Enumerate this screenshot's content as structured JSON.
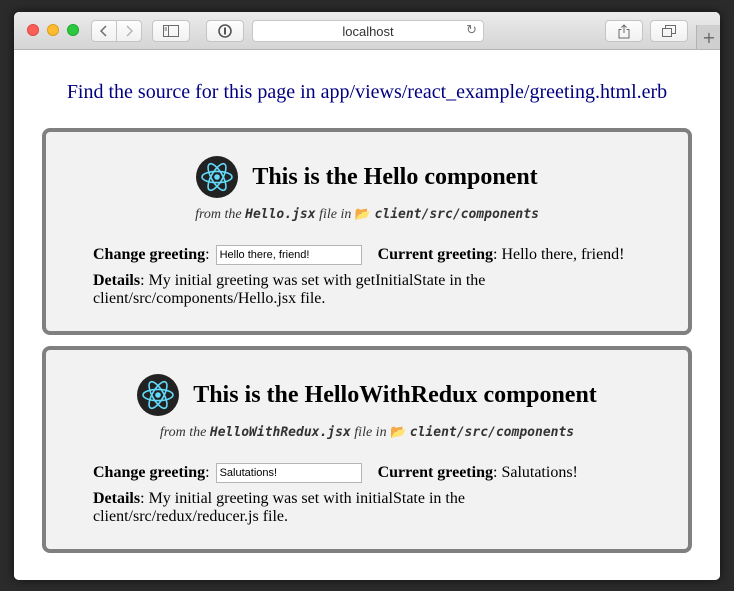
{
  "browser": {
    "address": "localhost",
    "new_tab_symbol": "+",
    "icons": [
      "back-icon",
      "forward-icon",
      "sidebar-icon",
      "privacy-icon",
      "reload-icon",
      "share-icon",
      "tabs-icon"
    ]
  },
  "page": {
    "source_line": "Find the source for this page in app/views/react_example/greeting.html.erb"
  },
  "cards": [
    {
      "title": "This is the Hello component",
      "from_prefix": "from the",
      "file": "Hello.jsx",
      "file_in": "file in",
      "folder": "client/src/components",
      "change_label": "Change greeting",
      "input_value": "Hello there, friend!",
      "current_label": "Current greeting",
      "current_value": "Hello there, friend!",
      "details_label": "Details",
      "details_text": "My initial greeting was set with getInitialState in the client/src/components/Hello.jsx file."
    },
    {
      "title": "This is the HelloWithRedux component",
      "from_prefix": "from the",
      "file": "HelloWithRedux.jsx",
      "file_in": "file in",
      "folder": "client/src/components",
      "change_label": "Change greeting",
      "input_value": "Salutations!",
      "current_label": "Current greeting",
      "current_value": "Salutations!",
      "details_label": "Details",
      "details_text": "My initial greeting was set with initialState in the client/src/redux/reducer.js file."
    }
  ],
  "colors": {
    "link_blue": "#000080",
    "card_border": "#808080",
    "card_bg": "#f2f2f2",
    "react_cyan": "#61dafb"
  }
}
